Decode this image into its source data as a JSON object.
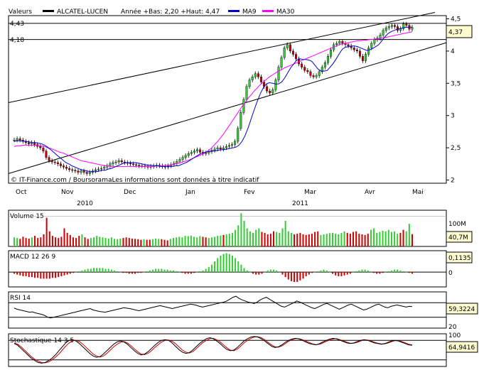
{
  "header": {
    "valeurs_label": "Valeurs",
    "stock_name": "ALCATEL-LUCEN",
    "range_text": "Année +Bas: 2,20 +Haut: 4,47",
    "ma9_label": "MA9",
    "ma30_label": "MA30"
  },
  "colors": {
    "up": "#33cc33",
    "down": "#cc0000",
    "ma9": "#0000cc",
    "ma30": "#ff00ff",
    "price_line": "#000000",
    "grid": "#000000"
  },
  "credit": "© IT-Finance.com / BoursoramaLes informations sont données à titre indicatif",
  "x_axis": {
    "months": [
      "Oct",
      "Nov",
      "Dec",
      "Jan",
      "Fev",
      "Mar",
      "Avr",
      "Mai"
    ],
    "years": [
      "2010",
      "2011"
    ]
  },
  "chart_data": [
    {
      "type": "candlestick",
      "title": "ALCATEL-LUCEN",
      "ylim": [
        1.95,
        4.55
      ],
      "ticks": [
        "4,5",
        "4",
        "3,5",
        "3",
        "2,5",
        "2"
      ],
      "ref_lines": [
        {
          "label": "4,43",
          "value": 4.43
        },
        {
          "label": "4,18",
          "value": 4.18
        }
      ],
      "last_value_label": "4,37",
      "last_value": 4.37,
      "year_low": 2.2,
      "year_high": 4.47,
      "closes": [
        2.62,
        2.64,
        2.62,
        2.6,
        2.58,
        2.56,
        2.58,
        2.55,
        2.52,
        2.5,
        2.45,
        2.35,
        2.3,
        2.28,
        2.27,
        2.25,
        2.22,
        2.2,
        2.18,
        2.16,
        2.15,
        2.14,
        2.12,
        2.14,
        2.12,
        2.1,
        2.12,
        2.14,
        2.16,
        2.17,
        2.18,
        2.2,
        2.22,
        2.25,
        2.27,
        2.28,
        2.3,
        2.28,
        2.27,
        2.26,
        2.25,
        2.24,
        2.23,
        2.22,
        2.22,
        2.21,
        2.2,
        2.21,
        2.22,
        2.23,
        2.22,
        2.21,
        2.2,
        2.22,
        2.24,
        2.26,
        2.29,
        2.32,
        2.35,
        2.38,
        2.41,
        2.43,
        2.45,
        2.47,
        2.43,
        2.41,
        2.42,
        2.44,
        2.46,
        2.48,
        2.5,
        2.48,
        2.5,
        2.52,
        2.54,
        2.55,
        2.6,
        2.8,
        3.05,
        3.25,
        3.45,
        3.55,
        3.6,
        3.65,
        3.6,
        3.52,
        3.45,
        3.38,
        3.35,
        3.4,
        3.55,
        3.75,
        3.9,
        4.05,
        4.1,
        4.0,
        3.95,
        3.88,
        3.8,
        3.75,
        3.7,
        3.68,
        3.62,
        3.6,
        3.62,
        3.68,
        3.75,
        3.82,
        3.92,
        4.02,
        4.1,
        4.12,
        4.15,
        4.12,
        4.1,
        4.08,
        4.05,
        4.02,
        4.0,
        3.92,
        3.85,
        3.95,
        4.05,
        4.12,
        4.18,
        4.2,
        4.25,
        4.32,
        4.36,
        4.38,
        4.4,
        4.38,
        4.32,
        4.35,
        4.42,
        4.4,
        4.34,
        4.37
      ],
      "ma9": [
        2.6,
        2.61,
        2.61,
        2.6,
        2.6,
        2.59,
        2.58,
        2.58,
        2.57,
        2.56,
        2.54,
        2.51,
        2.47,
        2.43,
        2.39,
        2.35,
        2.31,
        2.27,
        2.25,
        2.22,
        2.2,
        2.18,
        2.16,
        2.15,
        2.14,
        2.13,
        2.13,
        2.13,
        2.14,
        2.15,
        2.15,
        2.17,
        2.18,
        2.2,
        2.22,
        2.24,
        2.26,
        2.27,
        2.27,
        2.27,
        2.27,
        2.26,
        2.25,
        2.24,
        2.23,
        2.23,
        2.22,
        2.22,
        2.21,
        2.21,
        2.21,
        2.21,
        2.21,
        2.22,
        2.22,
        2.24,
        2.26,
        2.28,
        2.31,
        2.34,
        2.37,
        2.4,
        2.42,
        2.43,
        2.44,
        2.45,
        2.45,
        2.46,
        2.47,
        2.47,
        2.48,
        2.49,
        2.5,
        2.51,
        2.54,
        2.6,
        2.69,
        2.81,
        2.95,
        3.09,
        3.22,
        3.34,
        3.43,
        3.49,
        3.51,
        3.5,
        3.49,
        3.49,
        3.52,
        3.58,
        3.66,
        3.74,
        3.8,
        3.86,
        3.88,
        3.87,
        3.87,
        3.86,
        3.84,
        3.78,
        3.72,
        3.69,
        3.69,
        3.7,
        3.75,
        3.81,
        3.88,
        3.96,
        4.03,
        4.06,
        4.07,
        4.08,
        4.08,
        4.07,
        4.05,
        4.03,
        4.01,
        4.02,
        4.04,
        4.07,
        4.1,
        4.16,
        4.22,
        4.27,
        4.3,
        4.32,
        4.34,
        4.35,
        4.36,
        4.37,
        4.37,
        4.37
      ],
      "ma30": [
        2.52,
        2.53,
        2.53,
        2.54,
        2.54,
        2.54,
        2.54,
        2.54,
        2.53,
        2.53,
        2.52,
        2.5,
        2.49,
        2.47,
        2.45,
        2.43,
        2.42,
        2.4,
        2.38,
        2.36,
        2.34,
        2.32,
        2.3,
        2.29,
        2.28,
        2.27,
        2.26,
        2.25,
        2.24,
        2.23,
        2.22,
        2.22,
        2.21,
        2.21,
        2.21,
        2.21,
        2.21,
        2.21,
        2.21,
        2.21,
        2.21,
        2.21,
        2.21,
        2.21,
        2.21,
        2.21,
        2.21,
        2.22,
        2.22,
        2.22,
        2.23,
        2.23,
        2.24,
        2.25,
        2.26,
        2.27,
        2.29,
        2.3,
        2.32,
        2.34,
        2.36,
        2.38,
        2.4,
        2.43,
        2.46,
        2.5,
        2.55,
        2.6,
        2.66,
        2.72,
        2.79,
        2.86,
        2.93,
        3.0,
        3.07,
        3.14,
        3.2,
        3.27,
        3.32,
        3.38,
        3.43,
        3.48,
        3.52,
        3.56,
        3.6,
        3.63,
        3.66,
        3.69,
        3.71,
        3.74,
        3.76,
        3.78,
        3.8,
        3.82,
        3.84,
        3.86,
        3.88,
        3.9,
        3.92,
        3.94,
        3.96,
        3.98,
        4.0,
        4.02,
        4.04,
        4.06,
        4.08,
        4.1,
        4.11,
        4.12,
        4.13,
        4.14,
        4.15,
        4.16,
        4.16,
        4.17,
        4.17,
        4.18,
        4.18,
        4.19,
        4.19,
        4.2,
        4.21,
        4.22,
        4.23,
        4.24,
        4.25,
        4.26,
        4.27,
        4.28,
        4.29,
        4.3
      ]
    },
    {
      "type": "bar",
      "title": "Volume 15",
      "ylim": [
        0,
        120
      ],
      "ticks": [
        "100M"
      ],
      "last_value_label": "40,7M",
      "last_value": 40.7,
      "values": [
        30,
        28,
        25,
        32,
        28,
        26,
        30,
        35,
        28,
        30,
        40,
        95,
        50,
        35,
        30,
        28,
        32,
        60,
        45,
        38,
        30,
        28,
        35,
        40,
        30,
        25,
        28,
        30,
        35,
        32,
        30,
        28,
        26,
        30,
        25,
        24,
        26,
        28,
        30,
        28,
        26,
        25,
        24,
        22,
        24,
        22,
        22,
        24,
        26,
        25,
        24,
        22,
        20,
        25,
        28,
        30,
        32,
        30,
        35,
        34,
        36,
        32,
        30,
        34,
        32,
        30,
        28,
        30,
        32,
        35,
        36,
        38,
        40,
        42,
        45,
        55,
        70,
        110,
        85,
        60,
        50,
        45,
        55,
        60,
        48,
        45,
        40,
        42,
        50,
        48,
        45,
        60,
        85,
        50,
        45,
        40,
        42,
        45,
        40,
        38,
        40,
        42,
        48,
        50,
        38,
        40,
        42,
        44,
        45,
        42,
        40,
        45,
        50,
        45,
        42,
        48,
        50,
        42,
        40,
        38,
        42,
        55,
        60,
        45,
        48,
        52,
        50,
        55,
        48,
        50,
        42,
        45,
        55,
        50,
        75,
        40.7
      ]
    },
    {
      "type": "bar",
      "title": "MACD 12 26 9",
      "ylim": [
        -0.18,
        0.26
      ],
      "ticks": [
        "0"
      ],
      "last_value_label": "0,1135",
      "last_value": 0.1135,
      "values": [
        -0.02,
        -0.03,
        -0.04,
        -0.05,
        -0.05,
        -0.06,
        -0.06,
        -0.07,
        -0.07,
        -0.08,
        -0.08,
        -0.08,
        -0.08,
        -0.07,
        -0.07,
        -0.06,
        -0.05,
        -0.04,
        -0.03,
        -0.02,
        -0.01,
        0.0,
        0.01,
        0.02,
        0.03,
        0.04,
        0.04,
        0.05,
        0.05,
        0.05,
        0.05,
        0.04,
        0.04,
        0.03,
        0.02,
        0.01,
        0.0,
        -0.01,
        -0.01,
        -0.02,
        -0.02,
        -0.02,
        -0.01,
        -0.01,
        0.0,
        0.01,
        0.02,
        0.03,
        0.04,
        0.04,
        0.04,
        0.03,
        0.03,
        0.02,
        0.02,
        0.01,
        0.0,
        -0.01,
        -0.02,
        -0.02,
        -0.02,
        -0.01,
        0.0,
        0.01,
        0.02,
        0.04,
        0.06,
        0.09,
        0.13,
        0.17,
        0.2,
        0.22,
        0.23,
        0.22,
        0.2,
        0.17,
        0.13,
        0.09,
        0.05,
        0.02,
        0.0,
        -0.02,
        -0.03,
        -0.03,
        -0.02,
        0.0,
        0.02,
        0.03,
        0.03,
        0.02,
        0.0,
        -0.03,
        -0.06,
        -0.09,
        -0.11,
        -0.12,
        -0.12,
        -0.1,
        -0.08,
        -0.05,
        -0.03,
        -0.01,
        0.0,
        0.01,
        0.02,
        0.03,
        0.02,
        0.0,
        -0.02,
        -0.04,
        -0.05,
        -0.05,
        -0.04,
        -0.03,
        -0.02,
        0.0,
        0.01,
        0.02,
        0.03,
        0.03,
        0.02,
        0.0,
        -0.01,
        -0.02,
        -0.02,
        -0.01,
        0.0,
        0.01,
        0.02,
        0.03,
        0.03,
        0.02,
        0.01,
        0.0,
        -0.01,
        -0.02
      ]
    },
    {
      "type": "line",
      "title": "RSI 14",
      "ylim": [
        0,
        100
      ],
      "ref_lines": [
        70,
        30
      ],
      "ticks": [
        "20"
      ],
      "last_value_label": "59,3224",
      "last_value": 59.3224,
      "values": [
        55,
        52,
        50,
        48,
        46,
        44,
        45,
        42,
        40,
        38,
        35,
        30,
        28,
        30,
        32,
        34,
        36,
        38,
        40,
        42,
        44,
        46,
        48,
        50,
        52,
        54,
        50,
        48,
        46,
        45,
        44,
        46,
        48,
        50,
        52,
        54,
        56,
        55,
        54,
        52,
        50,
        48,
        50,
        52,
        54,
        56,
        58,
        60,
        62,
        60,
        58,
        56,
        54,
        56,
        58,
        60,
        62,
        64,
        66,
        65,
        63,
        60,
        58,
        60,
        62,
        64,
        66,
        68,
        70,
        72,
        75,
        80,
        85,
        88,
        82,
        78,
        75,
        72,
        70,
        68,
        72,
        78,
        82,
        85,
        80,
        75,
        70,
        65,
        60,
        58,
        62,
        66,
        70,
        75,
        72,
        68,
        64,
        60,
        56,
        54,
        58,
        62,
        66,
        68,
        64,
        60,
        56,
        52,
        56,
        60,
        64,
        66,
        62,
        58,
        54,
        50,
        52,
        56,
        60,
        64,
        66,
        62,
        58,
        56,
        60,
        62,
        64,
        62,
        60,
        58,
        60,
        59.3224
      ]
    },
    {
      "type": "line",
      "title": "Stochastique 14 3 5",
      "ylim": [
        0,
        100
      ],
      "ref_lines": [
        80,
        20
      ],
      "ticks": [
        "100"
      ],
      "last_value_label": "64,9416",
      "series": [
        {
          "values": [
            70,
            65,
            55,
            45,
            35,
            25,
            18,
            12,
            10,
            12,
            18,
            25,
            35,
            48,
            60,
            72,
            80,
            82,
            78,
            70,
            60,
            50,
            40,
            32,
            28,
            30,
            38,
            48,
            58,
            68,
            75,
            78,
            75,
            68,
            58,
            48,
            40,
            35,
            38,
            45,
            55,
            65,
            74,
            80,
            82,
            80,
            72,
            62,
            52,
            44,
            40,
            42,
            50,
            60,
            70,
            78,
            85,
            88,
            85,
            78,
            70,
            60,
            52,
            48,
            50,
            58,
            68,
            78,
            85,
            90,
            92,
            90,
            85,
            78,
            70,
            62,
            58,
            60,
            66,
            74,
            80,
            84,
            86,
            84,
            80,
            75,
            70,
            68,
            66,
            70,
            75,
            80,
            84,
            86,
            84,
            80,
            76,
            72,
            70,
            72,
            76,
            80,
            82,
            80,
            76,
            72,
            70,
            68,
            70,
            74,
            78,
            80,
            78,
            74,
            70,
            66,
            64.9416
          ]
        },
        {
          "values": [
            72,
            68,
            60,
            50,
            40,
            30,
            22,
            16,
            12,
            11,
            14,
            20,
            28,
            38,
            50,
            62,
            72,
            79,
            80,
            76,
            68,
            58,
            48,
            38,
            32,
            29,
            32,
            40,
            50,
            60,
            68,
            74,
            76,
            72,
            64,
            54,
            45,
            38,
            36,
            40,
            48,
            58,
            67,
            75,
            80,
            81,
            77,
            70,
            60,
            50,
            44,
            41,
            45,
            54,
            64,
            73,
            80,
            85,
            86,
            82,
            75,
            66,
            57,
            50,
            48,
            53,
            62,
            72,
            80,
            86,
            90,
            91,
            88,
            82,
            74,
            66,
            60,
            59,
            63,
            70,
            77,
            82,
            85,
            85,
            82,
            78,
            73,
            69,
            67,
            68,
            72,
            77,
            81,
            84,
            85,
            82,
            78,
            74,
            71,
            71,
            74,
            78,
            81,
            81,
            78,
            74,
            71,
            69,
            69,
            72,
            76,
            79,
            79,
            76,
            72,
            68,
            66
          ]
        }
      ]
    }
  ]
}
